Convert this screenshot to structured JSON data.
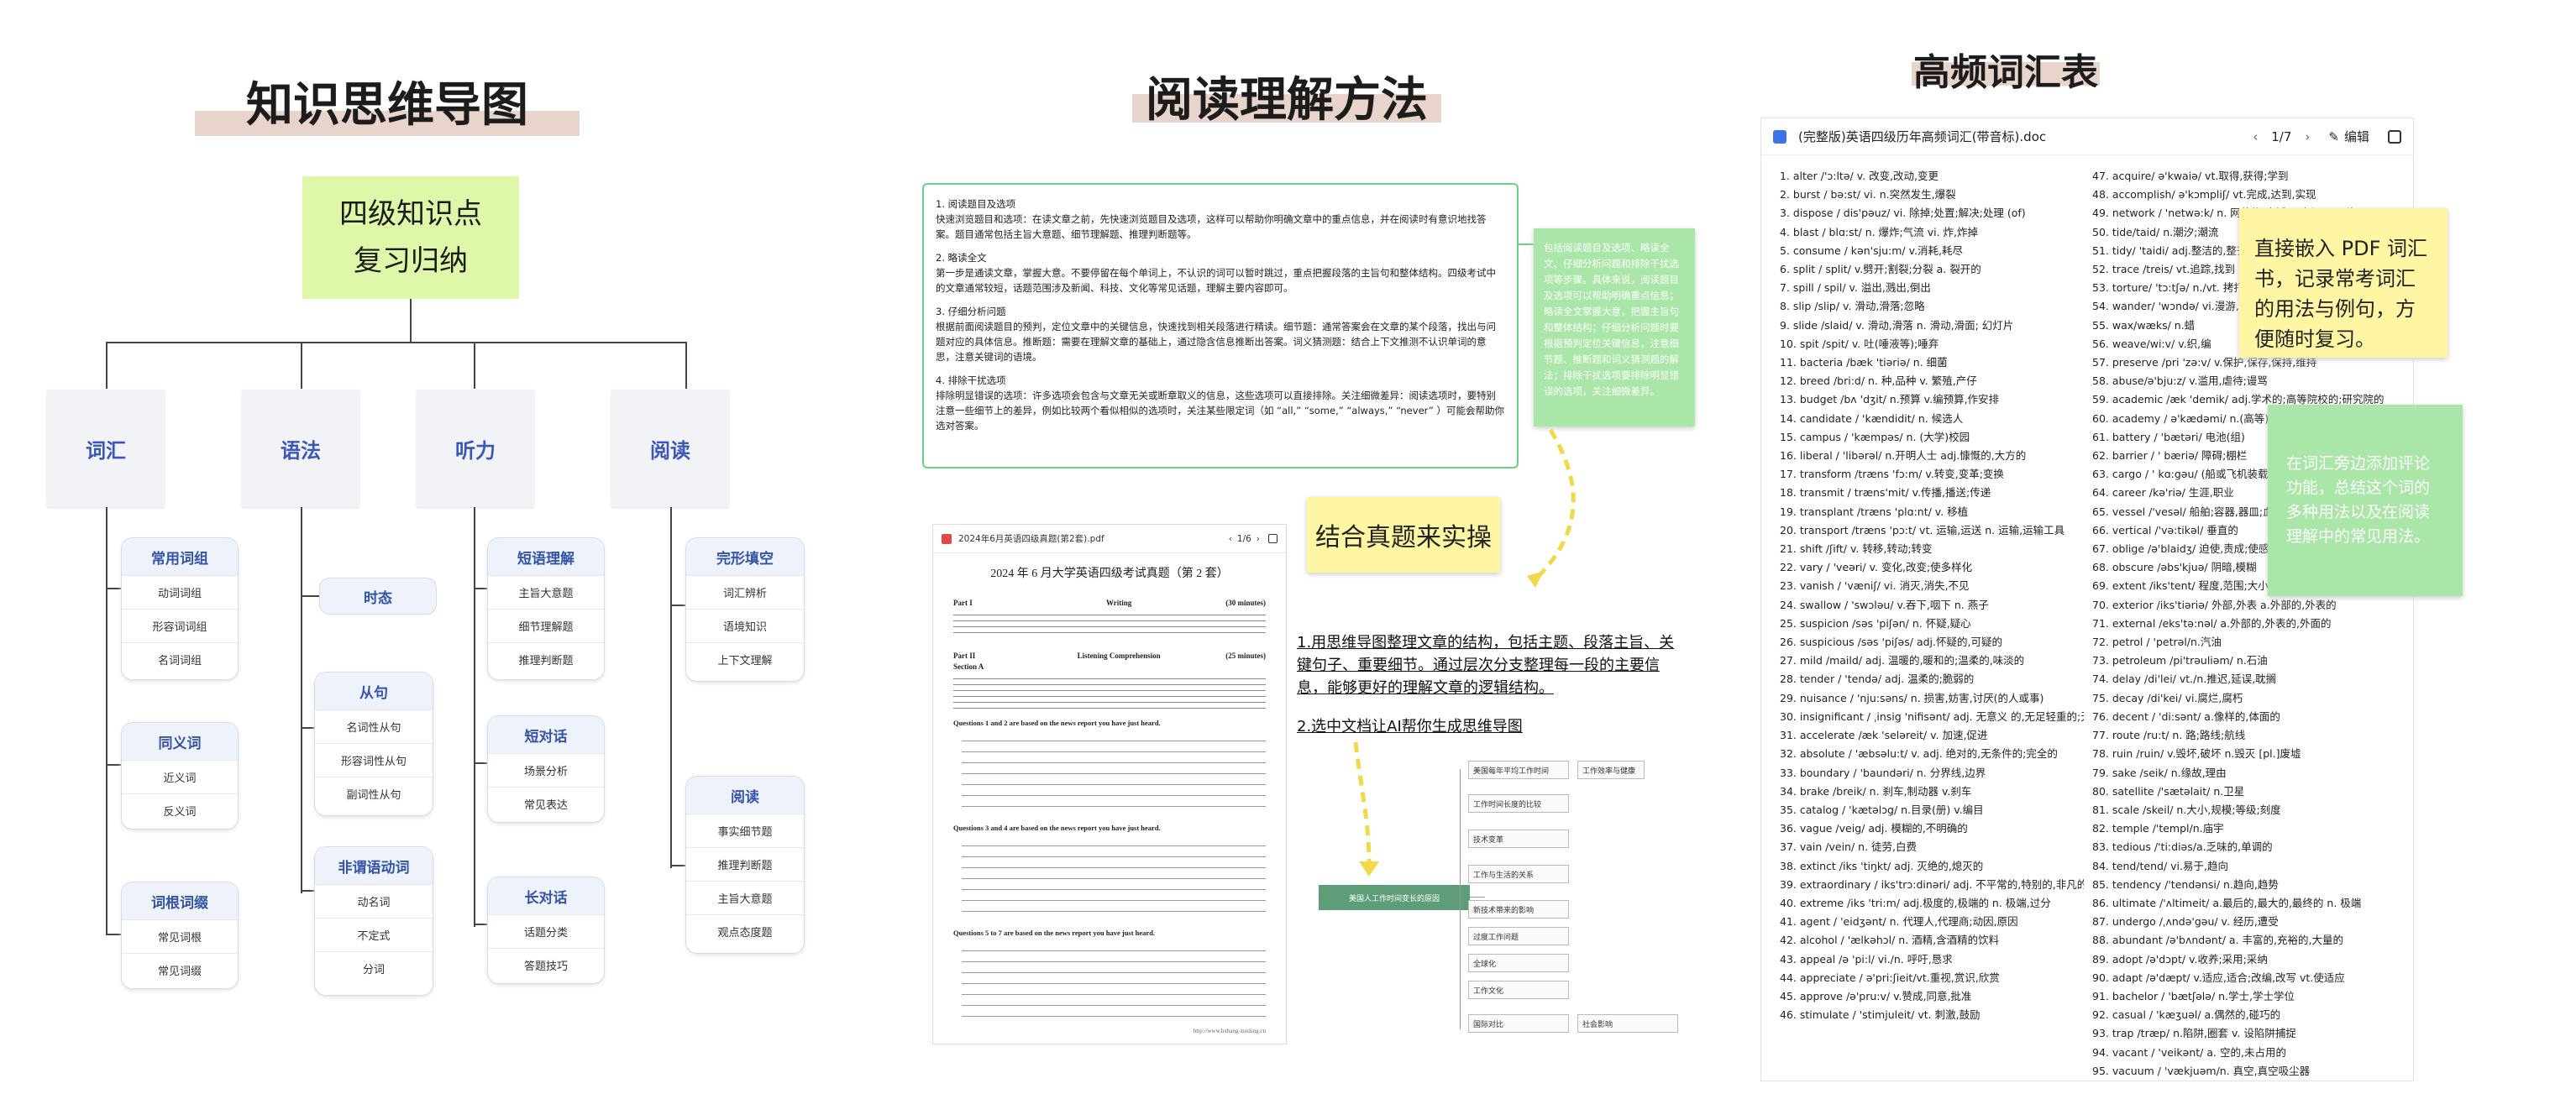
{
  "panels": {
    "mindmap_title": "知识思维导图",
    "reading_title": "阅读理解方法",
    "vocab_title": "高频词汇表"
  },
  "mindmap": {
    "root_line1": "四级知识点",
    "root_line2": "复习归纳",
    "categories": [
      "词汇",
      "语法",
      "听力",
      "阅读"
    ],
    "vocab_groups": [
      {
        "title": "常用词组",
        "items": [
          "动词词组",
          "形容词词组",
          "名词词组"
        ]
      },
      {
        "title": "同义词",
        "items": [
          "近义词",
          "反义词"
        ]
      },
      {
        "title": "词根词缀",
        "items": [
          "常见词根",
          "常见词缀"
        ]
      }
    ],
    "grammar_tense": "时态",
    "grammar_groups": [
      {
        "title": "从句",
        "items": [
          "名词性从句",
          "形容词性从句",
          "副词性从句"
        ]
      },
      {
        "title": "非谓语动词",
        "items": [
          "动名词",
          "不定式",
          "分词"
        ]
      }
    ],
    "listening_groups": [
      {
        "title": "短语理解",
        "items": [
          "主旨大意题",
          "细节理解题",
          "推理判断题"
        ]
      },
      {
        "title": "短对话",
        "items": [
          "场景分析",
          "常见表达"
        ]
      },
      {
        "title": "长对话",
        "items": [
          "话题分类",
          "答题技巧"
        ]
      }
    ],
    "reading_groups": [
      {
        "title": "完形填空",
        "items": [
          "词汇辨析",
          "语境知识",
          "上下文理解"
        ]
      },
      {
        "title": "阅读",
        "items": [
          "事实细节题",
          "推理判断题",
          "主旨大意题",
          "观点态度题"
        ]
      }
    ]
  },
  "reading": {
    "sections": [
      {
        "title": "1. 阅读题目及选项",
        "body": "快速浏览题目和选项：在读文章之前，先快速浏览题目及选项，这样可以帮助你明确文章中的重点信息，并在阅读时有意识地找答案。题目通常包括主旨大意题、细节理解题、推理判断题等。"
      },
      {
        "title": "2. 略读全文",
        "body": "第一步是通读文章，掌握大意。不要停留在每个单词上，不认识的词可以暂时跳过，重点把握段落的主旨句和整体结构。四级考试中的文章通常较短，话题范围涉及新闻、科技、文化等常见话题，理解主要内容即可。"
      },
      {
        "title": "3. 仔细分析问题",
        "body": "根据前面阅读题目的预判，定位文章中的关键信息，快速找到相关段落进行精读。细节题：通常答案会在文章的某个段落，找出与问题对应的具体信息。推断题：需要在理解文章的基础上，通过隐含信息推断出答案。词义猜测题：结合上下文推测不认识单词的意思，注意关键词的语境。"
      },
      {
        "title": "4. 排除干扰选项",
        "body": "排除明显错误的选项：许多选项会包含与文章无关或断章取义的信息，这些选项可以直接排除。关注细微差异：阅读选项时，要特别注意一些细节上的差异，例如比较两个看似相似的选项时，关注某些限定词（如 “all,” “some,” “always,” “never” ）可能会帮助你选对答案。"
      }
    ],
    "note_text": "包括阅读题目及选项、略读全文、仔细分析问题和排除干扰选项等步骤。具体来说，阅读题目及选项可以帮助明确重点信息；略读全文掌握大意，把握主旨句和整体结构；仔细分析问题时要根据预判定位关键信息，注意细节题、推断题和词义猜测题的解法；排除干扰选项要排除明显错误的选项，关注细微差异。",
    "practice_label": "结合真题来实操",
    "pdf_filename": "2024年6月英语四级真题(第2套).pdf",
    "pdf_page": "1/6",
    "pdf_heading": "2024 年 6 月大学英语四级考试真题（第 2 套）",
    "pdf_part1": "Part I",
    "pdf_part1_name": "Writing",
    "pdf_part1_time": "(30 minutes)",
    "pdf_part2": "Part II",
    "pdf_part2_name": "Listening Comprehension",
    "pdf_part2_time": "(25 minutes)",
    "pdf_section": "Section A",
    "pdf_q1": "Questions 1 and 2 are based on the news report you have just heard.",
    "pdf_q2": "Questions 3 and 4 are based on the news report you have just heard.",
    "pdf_q3": "Questions 5 to 7 are based on the news report you have just heard.",
    "pdf_footer": "http://www.hxbang-zuidsng.cn",
    "tip1": "1.用思维导图整理文章的结构，包括主题、段落主旨、关键句子、重要细节。通过层次分支整理每一段的主要信息，能够更好的理解文章的逻辑结构。",
    "tip2": "2.选中文档让AI帮你生成思维导图",
    "ai_root": "美国人工作时间变长的原因",
    "ai_nodes": [
      "美国每年平均工作时间",
      "工作时间长度的比较",
      "技术变革",
      "工作与生活的关系",
      "新技术带来的影响",
      "过度工作问题",
      "全球化",
      "工作文化",
      "国际对比",
      "工作效率与健康",
      "社会影响"
    ]
  },
  "vocab": {
    "doc_title": "(完整版)英语四级历年高频词汇(带音标).doc",
    "page": "1/7",
    "edit_label": "编辑",
    "col1": [
      "1.    alter  /'ɔ:ltə/   v. 改变,改动,变更",
      "2.  burst / bə:st/ vi. n.突然发生,爆裂",
      "3.  dispose / dis'pəuz/ vi. 除掉;处置;解决;处理 (of)",
      "4.  blast / blɑ:st/ n. 爆炸;气流  vi. 炸,炸掉",
      "5.  consume / kən'sju:m/ v.消耗,耗尽",
      "6.  split / split/  v.劈开;割裂;分裂  a. 裂开的",
      "7.  spill / spil/ v. 溢出,溅出,倒出",
      "8.  slip /slip/ v. 滑动,滑落;忽略",
      "9.  slide /slaid/ v. 滑动,滑落 n. 滑动,滑面; 幻灯片",
      "10.  spit   /spit/  v. 吐(唾液等);唾弃",
      "11.  bacteria /bæk 'tiəriə/ n. 细菌",
      "12.  breed /bri:d/ n. 种,品种  v. 繁殖,产仔",
      "13.  budget /bʌ 'dʒit/ n.预算  v.编预算,作安排",
      "14.  candidate / 'kændidit/ n. 候选人",
      "15.  campus / 'kæmpəs/ n. (大学)校园",
      "16.  liberal / 'libərəl/ n.开明人士  adj.慷慨的,大方的",
      "17.  transform /træns 'fɔ:m/ v.转变,变革;变换",
      "18.  transmit / træns'mit/ v.传播,播送;传递",
      "19.  transplant /træns 'plɑ:nt/ v. 移植",
      "20.  transport /træns 'pɔ:t/ vt. 运输,运送  n. 运输,运输工具",
      "21.  shift /ʃift/   v. 转移,转动;转变",
      "22.  vary / 'veəri/ v. 变化,改变;使多样化",
      "23.  vanish   / 'væniʃ/ vi. 消灭,消失,不见",
      "24.  swallow / 'swɔləu/ v.吞下,咽下 n. 燕子",
      "25.  suspicion /səs 'piʃən/   n. 怀疑,疑心",
      "26.  suspicious /səs 'piʃəs/ adj.怀疑的,可疑的",
      "27.  mild /maild/ adj. 温暖的,暖和的;温柔的,味淡的",
      "28.  tender / 'tendə/ adj. 温柔的;脆弱的",
      "29.  nuisance / 'nju:səns/ n. 损害,妨害,讨厌(的人或事)",
      "30.  insignificant / ˌinsig 'nifisənt/ adj. 无意义 的,无足轻重的;无价值的",
      "31.  accelerate /æk 'seləreit/ v. 加速,促进",
      "32.  absolute / 'æbsəlu:t/ v. adj. 绝对的,无条件的;完全的",
      "33.  boundary / 'baundəri/ n. 分界线,边界",
      "34.  brake /breik/ n. 刹车,制动器 v.刹车",
      "35.  catalog / 'kætəlɔg/ n.目录(册) v.编目",
      "36.  vague /veig/   adj. 模糊的,不明确的",
      "37.  vain /vein/ n. 徒劳,白费",
      "38.  extinct /iks 'tiŋkt/ adj. 灭绝的,熄灭的",
      "39.  extraordinary / iks'trɔ:dinəri/ adj. 不平常的,特别的,非凡的",
      "40.  extreme   /iks 'tri:m/ adj.极度的,极端的 n. 极端,过分",
      "41.  agent / 'eidʒənt/  n. 代理人,代理商;动因,原因",
      "42.  alcohol / 'ælkəhɔl/ n. 酒精,含酒精的饮料",
      "43.  appeal   /ə 'pi:l/ vi./n.  呼吁,恳求",
      "44.  appreciate / ə'pri:ʃieit/vt.重视,赏识,欣赏",
      "45.  approve /ə'pru:v/ v.赞成,同意,批准",
      "46.  stimulate / 'stimjuleit/ vt. 刺激,鼓励"
    ],
    "col2": [
      "47.  acquire/ ə'kwaiə/ vt.取得,获得;学到",
      "48.  accomplish/ ə'kɔmpliʃ/ vt.完成,达到,实现",
      "49.  network / 'netwə:k/ n. 网状物;广播网,电视网;网络",
      "50.  tide/taid/ n.潮汐;潮流",
      "51.  tidy/ 'taidi/ adj.整洁的,整齐的",
      "52.  trace /treis/ vt.追踪,找到 n.痕迹,踪迹",
      "53.  torture/ 'tɔ:tʃə/ n./vt. 拷打,折磨",
      "54.  wander/ 'wɔndə/ vi.漫游,闲逛",
      "55.  wax/wæks/ n.蜡",
      "56.  weave/wi:v/ v.织,编",
      "57.  preserve /pri 'zə:v/ v.保护,保存,保持,维持",
      "58.  abuse/ə'bju:z/ v.滥用,虐待;谩骂",
      "59.  academic /æk 'demik/ adj.学术的;高等院校的;研究院的",
      "60.  academy / ə'kædəmi/ n.(高等)专科院校;学会",
      "61.  battery / 'bætəri/  电池(组)",
      "62.  barrier / '   bæriə/  障碍;棚栏",
      "63.  cargo / '   kɑ:gəu/ (船或飞机装载的)货物",
      "64.  career /kə'riə/ 生涯,职业",
      "65.  vessel /'vesəl/  船舶;容器,器皿;血管",
      "66.  vertical /'və:tikəl/  垂直的",
      "67.  oblige /ə'blaidʒ/  迫使,责成;使感激",
      "68.  obscure /əbs'kjuə/ 阴暗,模糊",
      "69.  extent /iks'tent/  程度,范围;大小,限度",
      "70.  exterior /iks'tiəriə/ 外部,外表 a.外部的,外表的",
      "71.  external /eks'tə:nəl/ a.外部的,外表的,外面的",
      "72.  petrol / 'petrəl/n.汽油",
      "73.  petroleum /pi'trəuliəm/ n.石油",
      "74.  delay /di'lei/ vt./n.推迟,延误,耽搁",
      "75.  decay /di'kei/ vi.腐烂,腐朽",
      "76.  decent / 'di:sənt/ a.像样的,体面的",
      "77.  route /ru:t/ n. 路;路线;航线",
      "78.  ruin /ruin/ v.毁坏,破坏 n.毁灭 [pl.]废墟",
      "79.  sake /seik/ n.缘故,理由",
      "80.  satellite /'sætəlait/ n.卫星",
      "81.  scale /skeil/ n.大小,规模;等级;刻度",
      "82.  temple /'templ/n.庙宇",
      "83.  tedious /'ti:diəs/a.乏味的,单调的",
      "84.  tend/tend/ vi.易于,趋向",
      "85.  tendency /'tendənsi/ n.趋向,趋势",
      "86.  ultimate /'ʌltimeit/ a.最后的,最大的,最终的 n. 极端",
      "87.  undergo /ˌʌndə'gəu/ v. 经历,遭受",
      "88.  abundant /ə'bʌndənt/ a. 丰富的,充裕的,大量的",
      "89.  adopt /ə'dɔpt/ v.收养;采用;采纳",
      "90.  adapt /ə'dæpt/ v.适应,适合;改编,改写  vt.使适应",
      "91.  bachelor / 'bætʃələ/ n.学士,学士学位",
      "92.  casual / 'kæʒuəl/ a.偶然的,碰巧的",
      "93.  trap /træp/ n.陷阱,圈套  v. 设陷阱捕捉",
      "94.  vacant / 'veikənt/ a. 空的,未占用的",
      "95.  vacuum / 'vækjuəm/n. 真空,真空吸尘器"
    ],
    "yellow_note": "直接嵌入 PDF 词汇书，记录常考词汇的用法与例句，方便随时复习。",
    "green_note": "在词汇旁边添加评论功能，总结这个词的多种用法以及在阅读理解中的常见用法。"
  }
}
